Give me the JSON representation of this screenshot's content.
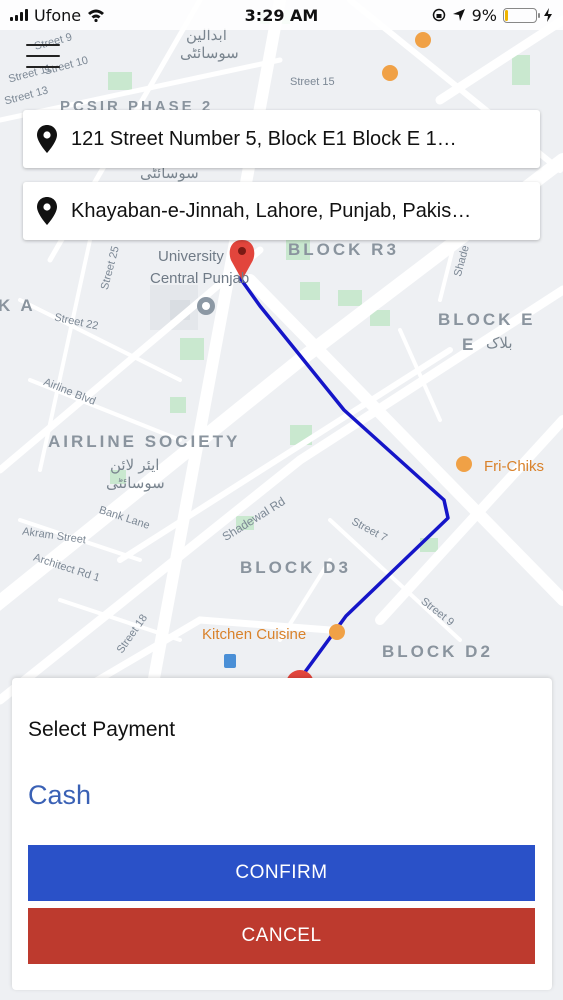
{
  "status_bar": {
    "carrier": "Ufone",
    "time": "3:29 AM",
    "battery_percent": "9%",
    "battery_level": 0.09,
    "icons": [
      "signal-icon",
      "wifi-icon",
      "orientation-lock-icon",
      "location-arrow-icon",
      "battery-icon",
      "charging-icon"
    ]
  },
  "map": {
    "labels": {
      "street_9": "Street 9",
      "street_10": "Street 10",
      "street_11": "Street 11",
      "street_13": "Street 13",
      "street_15": "Street 15",
      "pcsir": "PCSIR PHASE 2",
      "urdu_top1": "ابدالین",
      "urdu_top2": "سوسائٹی",
      "urdu_mid": "سوسائٹی",
      "university": "University",
      "central_punjab": "Central Punjab",
      "block_r3": "BLOCK R3",
      "shadewal_top": "Shade",
      "block_a": "K A",
      "street_25": "Street 25",
      "street_22": "Street 22",
      "block_e": "BLOCK E",
      "block_e2": "E",
      "urdu_block": "بلاک",
      "airline_blvd": "Airline Blvd",
      "airline_society": "AIRLINE SOCIETY",
      "urdu_airline1": "ایئر لائن",
      "urdu_airline2": "سوسائٹی",
      "fri_chiks": "Fri-Chiks",
      "shadewal_rd": "Shadewal Rd",
      "bank_lane": "Bank Lane",
      "street_7": "Street 7",
      "akram_street": "Akram Street",
      "architect_rd": "Architect Rd 1",
      "block_d3": "BLOCK D3",
      "street_9b": "Street 9",
      "street_18": "Street 18",
      "kitchen_cuisine": "Kitchen Cuisine",
      "block_d2": "BLOCK D2"
    },
    "route_color": "#1515c8",
    "marker_color": "#e2453c"
  },
  "menu": {
    "icon": "hamburger-menu-icon"
  },
  "pickup": {
    "address": "121 Street Number 5, Block E1 Block E 1…"
  },
  "dropoff": {
    "address": "Khayaban-e-Jinnah, Lahore, Punjab, Pakis…"
  },
  "payment": {
    "title": "Select Payment",
    "selected": "Cash",
    "confirm_label": "CONFIRM",
    "cancel_label": "CANCEL",
    "confirm_color": "#2a51c8",
    "cancel_color": "#bd3a2e"
  }
}
